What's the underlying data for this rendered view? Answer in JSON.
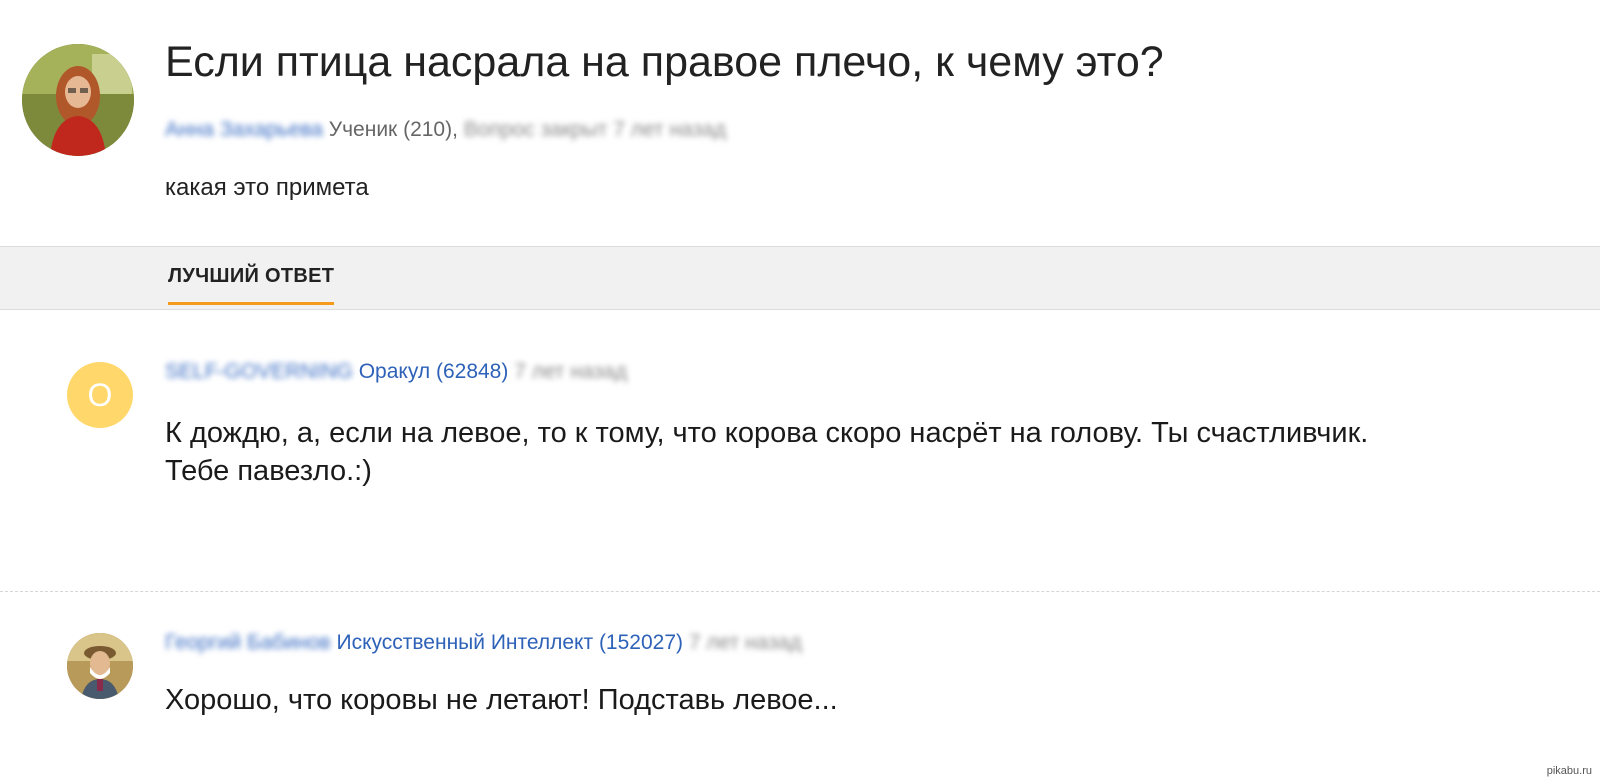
{
  "question": {
    "title": "Если птица насрала на правое плечо, к чему это?",
    "author_name": "Анна Захарьева",
    "author_rank": "Ученик (210),",
    "status": "Вопрос закрыт 7 лет назад",
    "text": "какая это примета"
  },
  "tabs": {
    "best_answer_label": "ЛУЧШИЙ ОТВЕТ",
    "active_color": "#f59a1b"
  },
  "answers": [
    {
      "avatar_letter": "О",
      "avatar_color": "#ffd76a",
      "author_name": "SELF-GOVERNING",
      "rank": "Оракул (62848)",
      "time": "7 лет назад",
      "text_line1": "К дождю, а, если на левое, то к тому, что корова скоро насрёт на голову. Ты счастливчик.",
      "text_line2": "Тебе павезло.:)"
    },
    {
      "avatar_icon": "user-photo-icon",
      "author_name": "Георгий Бабинов",
      "rank": "Искусственный Интеллект (152027)",
      "time": "7 лет назад",
      "text_line1": "Хорошо, что коровы не летают! Подставь левое..."
    }
  ],
  "watermark": "pikabu.ru",
  "colors": {
    "link_blue": "#2e62b8",
    "tab_bar_bg": "#f1f1f1",
    "accent_orange": "#f59a1b"
  }
}
